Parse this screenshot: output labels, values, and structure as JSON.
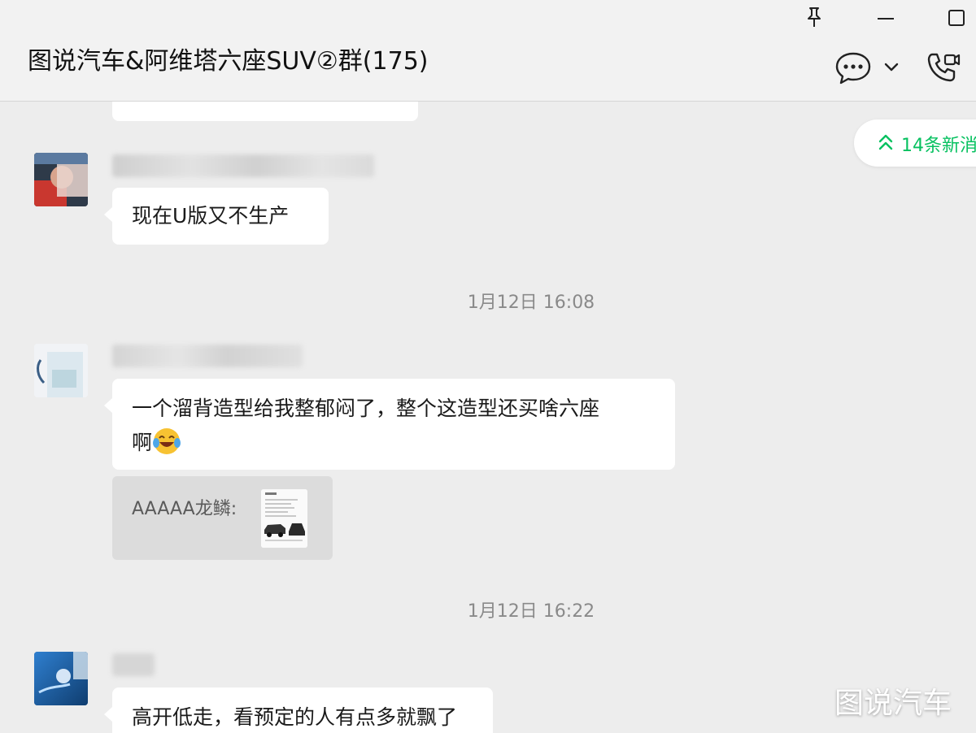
{
  "chat": {
    "title": "图说汽车&阿维塔六座SUV②群(175)"
  },
  "header_icons": {
    "pin": "pin-icon",
    "minimize": "minimize-icon",
    "maximize": "maximize-icon",
    "chat_info": "chat-bubble-icon",
    "dropdown": "chevron-down-icon",
    "call": "phone-video-icon"
  },
  "new_messages": {
    "label": "14条新消息"
  },
  "messages": [
    {
      "type": "text",
      "text": "现在U版又不生产"
    },
    {
      "type": "time",
      "text": "1月12日 16:08"
    },
    {
      "type": "text",
      "text": "一个溜背造型给我整郁闷了，整个这造型还买啥六座",
      "text_line2": "啊"
    },
    {
      "type": "quote",
      "sender": "AAAAA龙鳞:"
    },
    {
      "type": "time",
      "text": "1月12日 16:22"
    },
    {
      "type": "text",
      "text": "高开低走，看预定的人有点多就飘了"
    }
  ],
  "watermark": {
    "text": "图说汽车"
  },
  "colors": {
    "background": "#ededed",
    "bubble": "#ffffff",
    "accent_green": "#07c160",
    "timestamp": "#8a8a8a"
  }
}
